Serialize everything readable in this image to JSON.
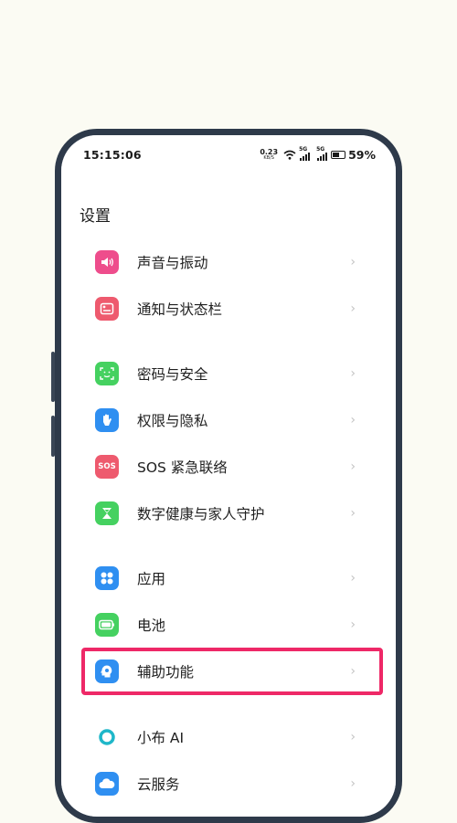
{
  "status_bar": {
    "time": "15:15:06",
    "net_speed_value": "0.23",
    "net_speed_unit": "KB/S",
    "sim1_tag": "5G",
    "sim2_tag": "5G",
    "battery_percent": "59%",
    "battery_level": 0.59
  },
  "page": {
    "title": "设置"
  },
  "menu": {
    "items": [
      {
        "label": "声音与振动",
        "icon": "speaker-icon",
        "color": "#ee4d8c"
      },
      {
        "label": "通知与状态栏",
        "icon": "notification-icon",
        "color": "#ee5a6e"
      },
      {
        "label": "密码与安全",
        "icon": "face-id-icon",
        "color": "#45d160"
      },
      {
        "label": "权限与隐私",
        "icon": "hand-icon",
        "color": "#2f8ff1"
      },
      {
        "label": "SOS 紧急联络",
        "icon": "sos-icon",
        "icon_text": "SOS",
        "color": "#ee5a6e"
      },
      {
        "label": "数字健康与家人守护",
        "icon": "hourglass-icon",
        "color": "#45d160"
      },
      {
        "label": "应用",
        "icon": "apps-grid-icon",
        "color": "#2f8ff1"
      },
      {
        "label": "电池",
        "icon": "battery-icon",
        "color": "#45d160"
      },
      {
        "label": "辅助功能",
        "icon": "accessibility-icon",
        "color": "#2f8ff1",
        "highlighted": true
      },
      {
        "label": "小布 AI",
        "icon": "ai-assistant-icon",
        "color": "#1fb7c9"
      },
      {
        "label": "云服务",
        "icon": "cloud-icon",
        "color": "#2f8ff1"
      }
    ]
  },
  "highlight_color": "#ee2867"
}
